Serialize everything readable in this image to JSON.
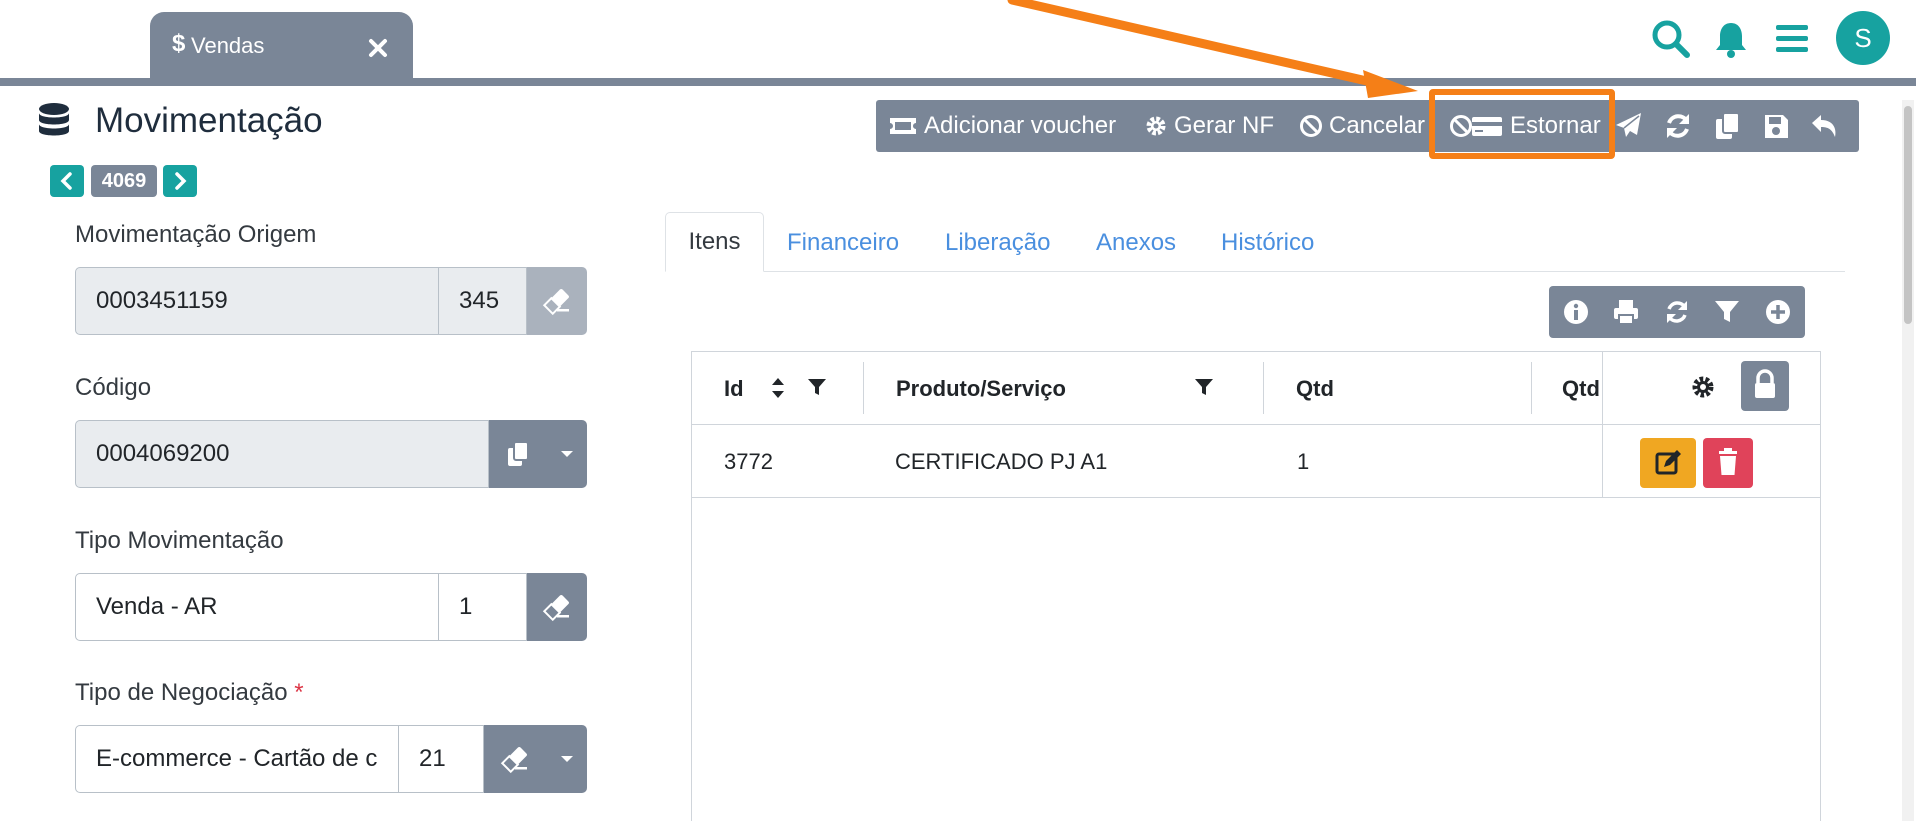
{
  "app_tab": {
    "icon": "dollar-icon",
    "symbol": "$",
    "label": "Vendas",
    "close_icon": "close-icon"
  },
  "top_icons": [
    "search-icon",
    "bell-icon",
    "menu-icon"
  ],
  "user": {
    "avatar_initial": "S"
  },
  "colors": {
    "accent": "#17a2a0",
    "toolbar": "#7a8697",
    "highlight": "#f57f17",
    "link": "#4a8fdf",
    "edit": "#f0a722",
    "delete": "#e0435a"
  },
  "header": {
    "title": "Movimentação",
    "icon": "database-icon",
    "record_id": "4069"
  },
  "toolbar": {
    "add_voucher": "Adicionar voucher",
    "generate_nf": "Gerar NF",
    "cancel": "Cancelar",
    "reverse": "Estornar",
    "icon_buttons": [
      "send-icon",
      "refresh-icon",
      "copy-icon",
      "save-icon",
      "undo-icon"
    ]
  },
  "form": {
    "origem": {
      "label": "Movimentação Origem",
      "value": "0003451159",
      "number": "345"
    },
    "codigo": {
      "label": "Código",
      "value": "0004069200"
    },
    "tipo_mov": {
      "label": "Tipo Movimentação",
      "value": "Venda - AR",
      "number": "1"
    },
    "tipo_neg": {
      "label": "Tipo de Negociação",
      "required_mark": "*",
      "value": "E-commerce - Cartão de c",
      "number": "21"
    }
  },
  "tabs": [
    {
      "label": "Itens",
      "active": true
    },
    {
      "label": "Financeiro"
    },
    {
      "label": "Liberação"
    },
    {
      "label": "Anexos"
    },
    {
      "label": "Histórico"
    }
  ],
  "grid_toolbar_icons": [
    "info-icon",
    "print-icon",
    "refresh-icon",
    "filter-icon",
    "add-icon"
  ],
  "table": {
    "headers": {
      "id": "Id",
      "product": "Produto/Serviço",
      "qty": "Qtd",
      "qty2": "Qtd"
    },
    "rows": [
      {
        "id": "3772",
        "product": "CERTIFICADO PJ A1",
        "qty": "1"
      }
    ]
  }
}
